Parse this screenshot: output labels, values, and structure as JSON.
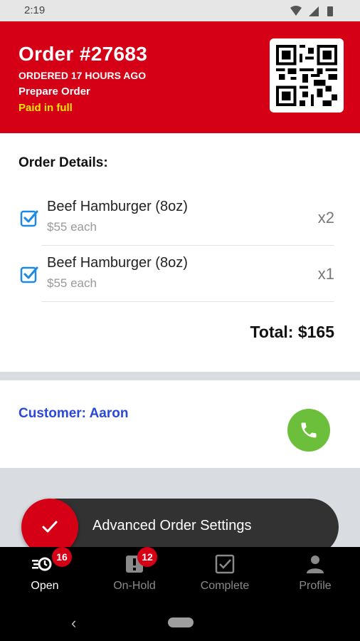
{
  "status_bar": {
    "time": "2:19",
    "icons": [
      "wifi-icon",
      "signal-icon",
      "battery-icon"
    ]
  },
  "header": {
    "title": "Order #27683",
    "ordered_ago": "ORDERED 17 HOURS AGO",
    "status": "Prepare Order",
    "payment": "Paid in full",
    "qr_icon": "qr-code-icon"
  },
  "details": {
    "title": "Order Details:",
    "items": [
      {
        "name": "Beef Hamburger (8oz)",
        "price": "$55 each",
        "qty": "x2",
        "checked": true
      },
      {
        "name": "Beef Hamburger (8oz)",
        "price": "$55 each",
        "qty": "x1",
        "checked": true
      }
    ],
    "total": "Total: $165"
  },
  "customer": {
    "label": "Customer: Aaron",
    "call_icon": "phone-icon"
  },
  "snackbar": {
    "text": "Advanced Order Settings",
    "fab_icon": "checkmark-icon"
  },
  "bottom_nav": {
    "tabs": [
      {
        "label": "Open",
        "icon": "open-orders-icon",
        "badge": "16",
        "active": true
      },
      {
        "label": "On-Hold",
        "icon": "on-hold-icon",
        "badge": "12",
        "active": false
      },
      {
        "label": "Complete",
        "icon": "complete-icon",
        "badge": "",
        "active": false
      },
      {
        "label": "Profile",
        "icon": "profile-icon",
        "badge": "",
        "active": false
      }
    ]
  },
  "colors": {
    "brand_red": "#d60016",
    "paid_yellow": "#ffe600",
    "customer_blue": "#2a48d9",
    "call_green": "#6cbf3a",
    "check_blue": "#1e88e5"
  }
}
